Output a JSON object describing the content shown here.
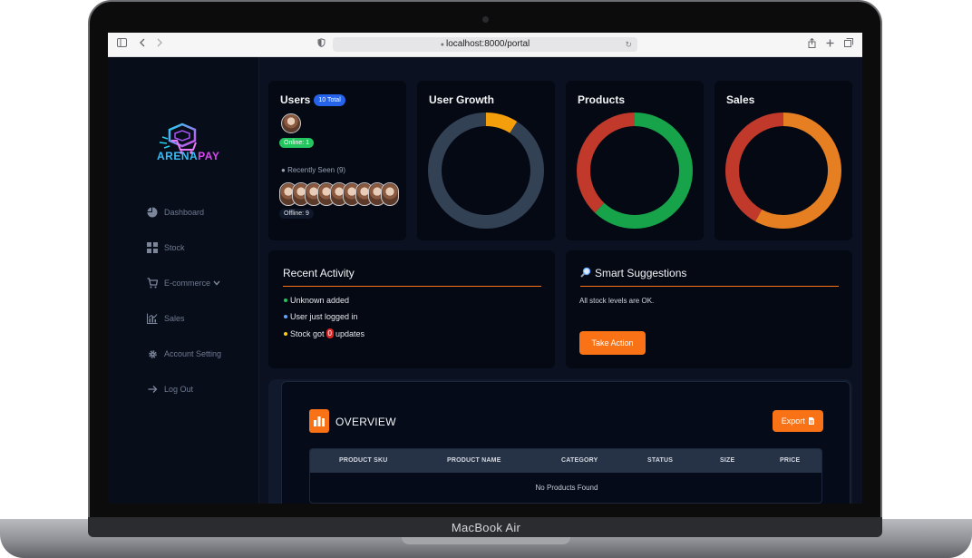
{
  "device": {
    "model": "MacBook Air"
  },
  "browser": {
    "url": "localhost:8000/portal",
    "icons": [
      "sidebar-toggle-icon",
      "back-icon",
      "forward-icon",
      "shield-icon",
      "lock-icon",
      "reload-icon",
      "share-icon",
      "new-tab-icon",
      "tabs-overview-icon"
    ]
  },
  "sidebar": {
    "logo": {
      "part1": "ARENA",
      "part2": "PAY"
    },
    "items": [
      {
        "label": "Dashboard",
        "icon": "pie-chart-icon"
      },
      {
        "label": "Stock",
        "icon": "grid-icon"
      },
      {
        "label": "E-commerce",
        "icon": "cart-icon",
        "has_dropdown": true
      },
      {
        "label": "Sales",
        "icon": "line-chart-icon"
      },
      {
        "label": "Account Setting",
        "icon": "gear-icon"
      },
      {
        "label": "Log Out",
        "icon": "logout-arrow-icon"
      }
    ]
  },
  "users_card": {
    "title": "Users",
    "total_badge": "10 Total",
    "online": "Online: 1",
    "recently_seen": "Recently Seen (9)",
    "offline": "Offline: 9"
  },
  "charts": {
    "user_growth": {
      "title": "User Growth",
      "colors": [
        "#f59e0b",
        "#334155"
      ]
    },
    "products": {
      "title": "Products",
      "colors": [
        "#16a34a",
        "#c0392b"
      ]
    },
    "sales": {
      "title": "Sales",
      "colors": [
        "#e67e22",
        "#c0392b"
      ]
    }
  },
  "chart_data": [
    {
      "type": "pie",
      "title": "User Growth",
      "values": [
        9,
        91
      ]
    },
    {
      "type": "pie",
      "title": "Products",
      "values": [
        62,
        38
      ]
    },
    {
      "type": "pie",
      "title": "Sales",
      "values": [
        58,
        42
      ]
    }
  ],
  "recent_activity": {
    "title": "Recent Activity",
    "items": [
      {
        "text": "Unknown added",
        "color": "#22c55e"
      },
      {
        "text": "User just logged in",
        "color": "#60a5fa"
      },
      {
        "prefix": "Stock got",
        "count": "0",
        "suffix": "updates",
        "color": "#facc15"
      }
    ]
  },
  "suggestions": {
    "title": "Smart Suggestions",
    "message": "All stock levels are OK.",
    "button": "Take Action"
  },
  "overview": {
    "title": "OVERVIEW",
    "export_button": "Export",
    "columns": [
      "PRODUCT SKU",
      "PRODUCT NAME",
      "CATEGORY",
      "STATUS",
      "SIZE",
      "PRICE"
    ],
    "empty_message": "No Products Found"
  }
}
